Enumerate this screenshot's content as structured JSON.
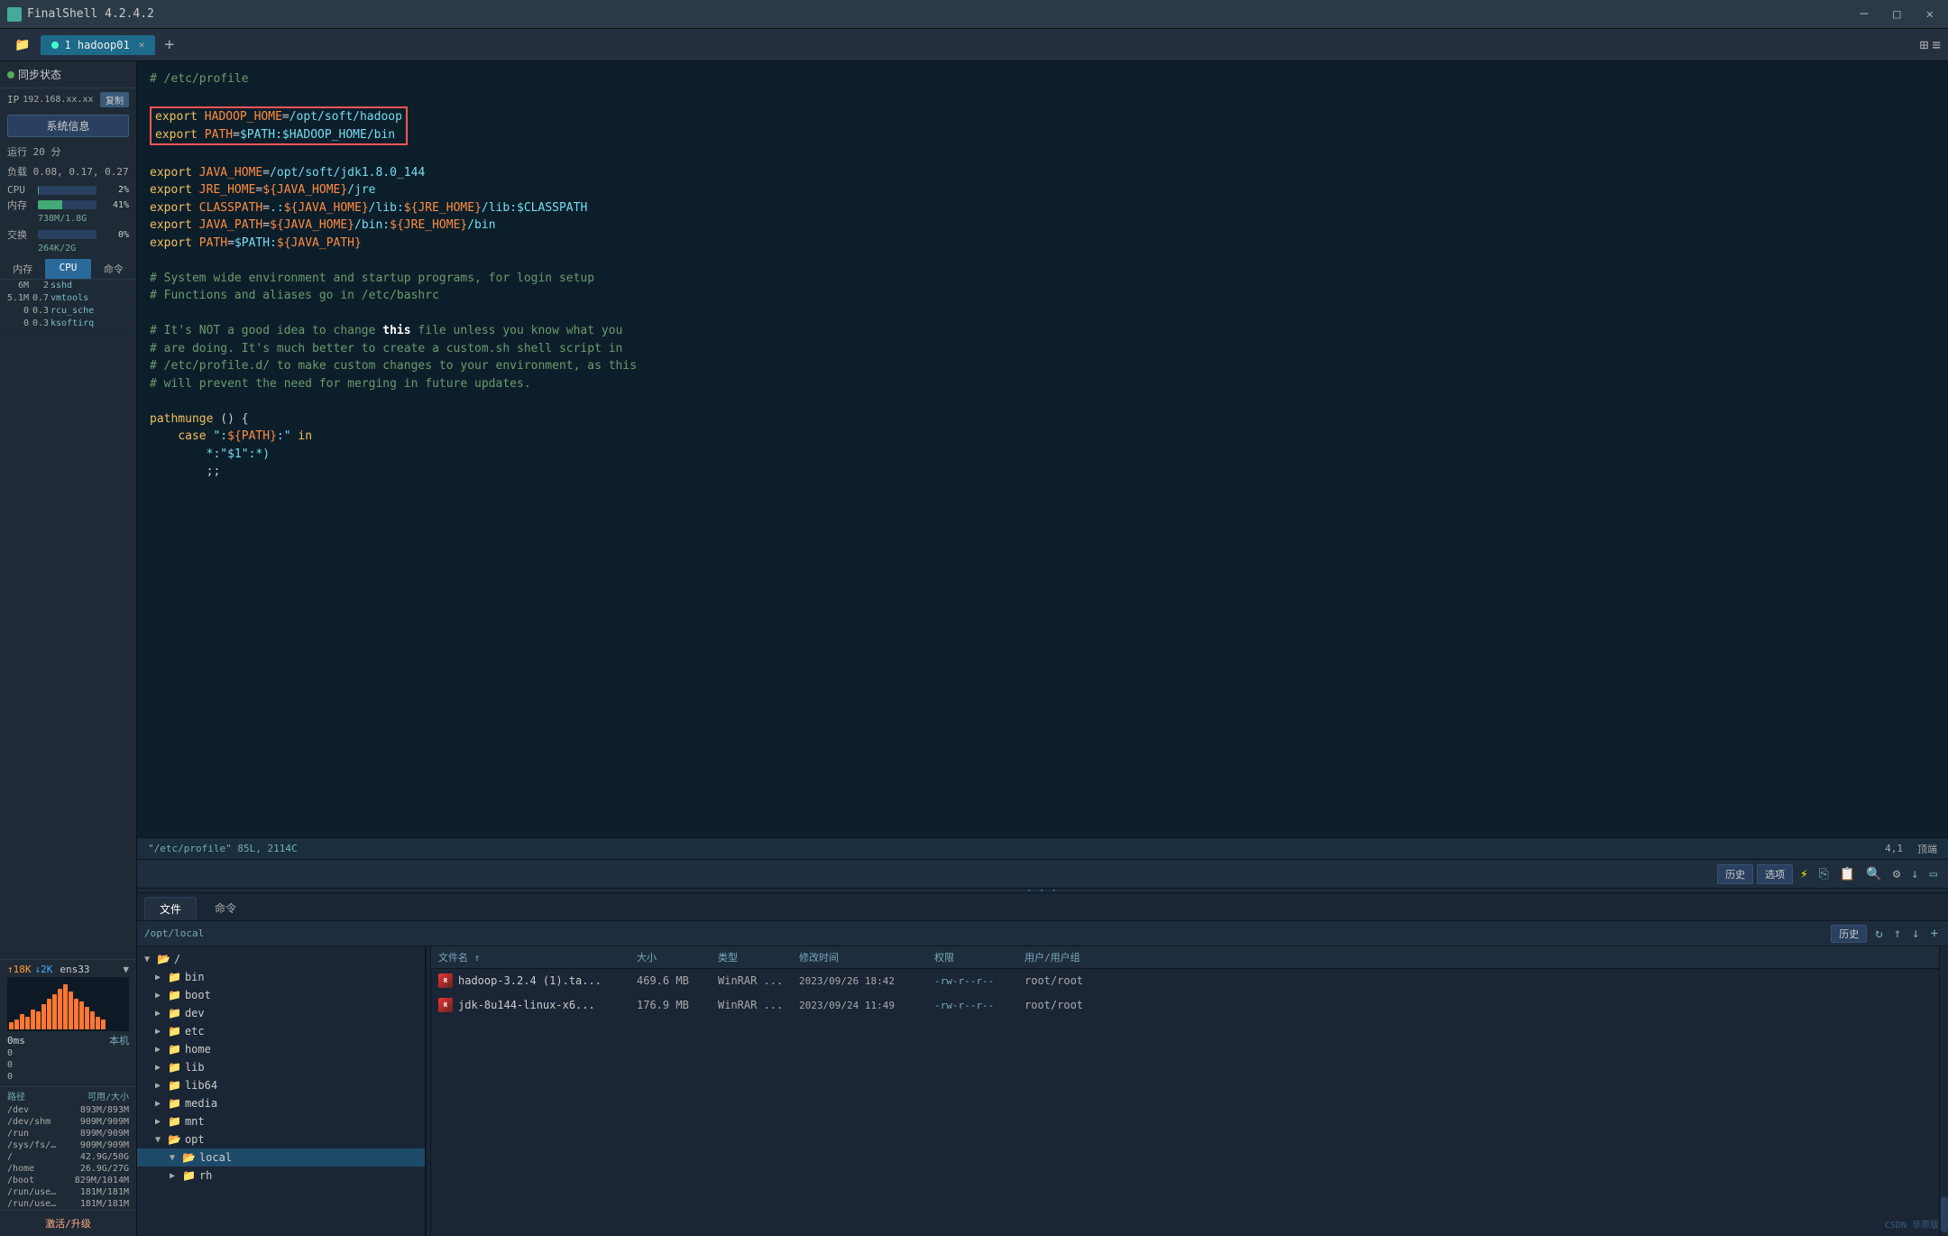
{
  "app": {
    "title": "FinalShell 4.2.4.2",
    "icon": "shell-icon"
  },
  "titlebar": {
    "title": "FinalShell 4.2.4.2",
    "minimize_label": "─",
    "maximize_label": "□",
    "close_label": "✕"
  },
  "tabs": [
    {
      "label": "1 hadoop01",
      "active": true
    }
  ],
  "tab_add": "+",
  "sidebar": {
    "sync_label": "同步状态",
    "ip_label": "IP",
    "ip_value": "192.168.xx.xx",
    "copy_label": "复制",
    "sys_info_btn": "系统信息",
    "runtime_label": "运行 20 分",
    "load_label": "负载 0.08, 0.17, 0.27",
    "cpu_label": "CPU",
    "cpu_val": "2%",
    "mem_label": "内存",
    "mem_val": "41%",
    "mem_detail": "738M/1.8G",
    "swap_label": "交换",
    "swap_val": "0%",
    "swap_detail": "264K/2G",
    "proc_tabs": [
      "内存",
      "CPU",
      "命令"
    ],
    "proc_active": 1,
    "processes": [
      {
        "mem": "6M",
        "cpu": "2",
        "cmd": "sshd"
      },
      {
        "mem": "5.1M",
        "cpu": "0.7",
        "cmd": "vmtools"
      },
      {
        "mem": "0",
        "cpu": "0.3",
        "cmd": "rcu_sche"
      },
      {
        "mem": "0",
        "cpu": "0.3",
        "cmd": "ksoftirq"
      }
    ],
    "net_up": "↑18K",
    "net_down": "↓2K",
    "net_iface": "ens33",
    "ping_label": "0ms",
    "host_label": "本机",
    "ping_rows": [
      {
        "val": "0",
        "label": ""
      },
      {
        "val": "0",
        "label": ""
      },
      {
        "val": "0",
        "label": ""
      }
    ],
    "disk_header_path": "路径",
    "disk_header_avail": "可用/大小",
    "disks": [
      {
        "path": "/dev",
        "avail": "893M/893M"
      },
      {
        "path": "/dev/shm",
        "avail": "909M/909M"
      },
      {
        "path": "/run",
        "avail": "899M/909M"
      },
      {
        "path": "/sys/fs/c...",
        "avail": "909M/909M"
      },
      {
        "path": "/",
        "avail": "42.9G/50G"
      },
      {
        "path": "/home",
        "avail": "26.9G/27G"
      },
      {
        "path": "/boot",
        "avail": "829M/1014M"
      },
      {
        "path": "/run/use...",
        "avail": "181M/181M"
      },
      {
        "path": "/run/use...",
        "avail": "181M/181M"
      }
    ],
    "activate_label": "激活/升级"
  },
  "terminal": {
    "content_lines": [
      {
        "type": "comment",
        "text": "# /etc/profile"
      },
      {
        "type": "blank",
        "text": ""
      },
      {
        "type": "export-highlight",
        "text": "export HADOOP_HOME=/opt/soft/hadoop"
      },
      {
        "type": "export-highlight",
        "text": "export PATH=$PATH:$HADOOP_HOME/bin"
      },
      {
        "type": "blank",
        "text": ""
      },
      {
        "type": "export",
        "text": "export JAVA_HOME=/opt/soft/jdk1.8.0_144"
      },
      {
        "type": "export",
        "text": "export JRE_HOME=${JAVA_HOME}/jre"
      },
      {
        "type": "export",
        "text": "export CLASSPATH=.:${JAVA_HOME}/lib:${JRE_HOME}/lib:$CLASSPATH"
      },
      {
        "type": "export",
        "text": "export JAVA_PATH=${JAVA_HOME}/bin:${JRE_HOME}/bin"
      },
      {
        "type": "export",
        "text": "export PATH=$PATH:${JAVA_PATH}"
      },
      {
        "type": "blank",
        "text": ""
      },
      {
        "type": "comment",
        "text": "# System wide environment and startup programs, for login setup"
      },
      {
        "type": "comment",
        "text": "# Functions and aliases go in /etc/bashrc"
      },
      {
        "type": "blank",
        "text": ""
      },
      {
        "type": "comment",
        "text": "# It's NOT a good idea to change this file unless you know what you"
      },
      {
        "type": "comment",
        "text": "# are doing. It's much better to create a custom.sh shell script in"
      },
      {
        "type": "comment",
        "text": "# /etc/profile.d/ to make custom changes to your environment, as this"
      },
      {
        "type": "comment",
        "text": "# will prevent the need for merging in future updates."
      },
      {
        "type": "blank",
        "text": ""
      },
      {
        "type": "func",
        "text": "pathmunge () {"
      },
      {
        "type": "code",
        "text": "    case \":${PATH}:\" in"
      },
      {
        "type": "code2",
        "text": "        *:\"$1\":*)"
      },
      {
        "type": "code",
        "text": "        ;;"
      }
    ],
    "status_file": "\"/etc/profile\" 85L, 2114C",
    "cursor_pos": "4,1",
    "scroll_pos": "顶端"
  },
  "toolbar": {
    "history_label": "历史",
    "options_label": "选项"
  },
  "bottom": {
    "tabs": [
      "文件",
      "命令"
    ],
    "active_tab": 0,
    "current_path": "/opt/local",
    "history_btn": "历史",
    "root_dir": "/",
    "dirs": [
      {
        "name": "bin",
        "level": 1,
        "expanded": false
      },
      {
        "name": "boot",
        "level": 1,
        "expanded": false
      },
      {
        "name": "dev",
        "level": 1,
        "expanded": false
      },
      {
        "name": "etc",
        "level": 1,
        "expanded": false
      },
      {
        "name": "home",
        "level": 1,
        "expanded": false
      },
      {
        "name": "lib",
        "level": 1,
        "expanded": false
      },
      {
        "name": "lib64",
        "level": 1,
        "expanded": false
      },
      {
        "name": "media",
        "level": 1,
        "expanded": false
      },
      {
        "name": "mnt",
        "level": 1,
        "expanded": false
      },
      {
        "name": "opt",
        "level": 1,
        "expanded": true
      },
      {
        "name": "local",
        "level": 2,
        "expanded": true,
        "selected": true
      },
      {
        "name": "rh",
        "level": 2,
        "expanded": false
      }
    ],
    "file_headers": {
      "name": "文件名 ↑",
      "size": "大小",
      "type": "类型",
      "date": "修改时间",
      "perm": "权限",
      "user": "用户/用户组"
    },
    "files": [
      {
        "name": "hadoop-3.2.4 (1).ta...",
        "size": "469.6 MB",
        "type": "WinRAR ...",
        "date": "2023/09/26 18:42",
        "perm": "-rw-r--r--",
        "user": "root/root",
        "icon": "rar"
      },
      {
        "name": "jdk-8u144-linux-x6...",
        "size": "176.9 MB",
        "type": "WinRAR ...",
        "date": "2023/09/24 11:49",
        "perm": "-rw-r--r--",
        "user": "root/root",
        "icon": "rar"
      }
    ]
  },
  "watermark": "CSDN 非原版",
  "colors": {
    "accent": "#4a9",
    "highlight": "#f55",
    "comment": "#6a9a6a",
    "keyword": "#f0c060",
    "path": "#7de",
    "tab_active": "#1e6a8a"
  }
}
